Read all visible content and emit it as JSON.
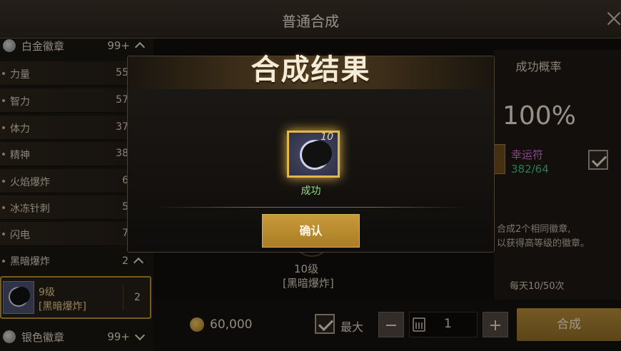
{
  "header": {
    "title": "普通合成"
  },
  "left_list": {
    "category_top": {
      "label": "白金徽章",
      "count": "99+"
    },
    "items": [
      {
        "label": "力量",
        "count": "55"
      },
      {
        "label": "智力",
        "count": "57"
      },
      {
        "label": "体力",
        "count": "37"
      },
      {
        "label": "精神",
        "count": "38"
      },
      {
        "label": "火焰爆炸",
        "count": "6"
      },
      {
        "label": "冰冻针刺",
        "count": "5"
      },
      {
        "label": "闪电",
        "count": "7"
      },
      {
        "label": "黑暗爆炸",
        "count": "2"
      }
    ],
    "selected": {
      "level": "9级",
      "name": "[黑暗爆炸]",
      "qty": "2"
    },
    "category_bottom": {
      "label": "银色徽章",
      "count": "99+"
    }
  },
  "right": {
    "rate_header": "成功概率",
    "rate_value": "100%",
    "luck_name": "幸运符",
    "luck_count": "382/64",
    "tip_line1": "合成2个相同徽章,",
    "tip_line2": "以获得高等级的徽章。",
    "daily": "每天10/50次"
  },
  "center": {
    "level": "10级",
    "name": "[黑暗爆炸]"
  },
  "bottom": {
    "gold": "60,000",
    "max_label": "最大",
    "qty": "1",
    "synth_label": "合成"
  },
  "modal": {
    "title": "合成结果",
    "item_level": "10",
    "status": "成功",
    "confirm_label": "确认"
  },
  "colors": {
    "accent_gold": "#b38a38",
    "success_green": "#8ee07e",
    "luck_purple": "#d96ad8",
    "luck_count_green": "#3dbf83"
  }
}
